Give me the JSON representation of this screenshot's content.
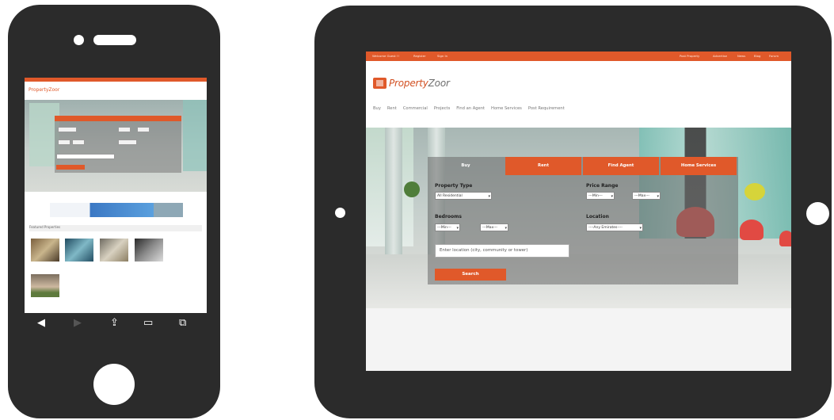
{
  "tablet": {
    "topbar_left": [
      "Welcome Guest !!",
      "Register",
      "Sign In"
    ],
    "topbar_right": [
      "Post Property",
      "Advertise",
      "News",
      "Blog",
      "Forum"
    ],
    "logo_brand": "Property",
    "logo_suffix": "Zoor",
    "nav": [
      "Buy",
      "Rent",
      "Commercial",
      "Projects",
      "Find an Agent",
      "Home Services",
      "Post Requirement"
    ],
    "search": {
      "tabs": [
        "Buy",
        "Rent",
        "Find Agent",
        "Home Services"
      ],
      "property_type_label": "Property Type",
      "property_type_value": "All Residential",
      "price_range_label": "Price Range",
      "price_min": "---Min---",
      "price_max": "---Max---",
      "bedrooms_label": "Bedrooms",
      "bedrooms_min": "---Min---",
      "bedrooms_max": "---Max---",
      "location_label": "Location",
      "location_value": "----Any Emirates----",
      "location_placeholder": "Enter location (city, community or tower)",
      "search_button": "Search"
    }
  },
  "phone": {
    "logo": "PropertyZoor",
    "section_title": "Featured Properties"
  },
  "colors": {
    "accent": "#e0592a",
    "device": "#2b2b2b"
  }
}
